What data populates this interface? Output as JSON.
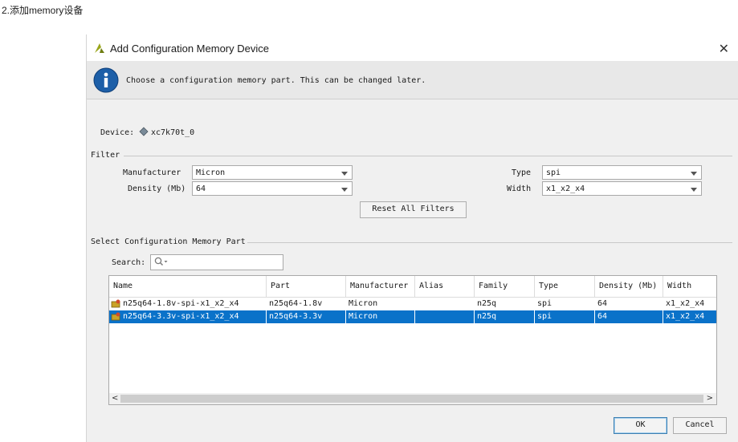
{
  "caption": "2.添加memory设备",
  "dialog": {
    "title": "Add Configuration Memory Device",
    "info_text": "Choose a configuration memory part. This can be changed later.",
    "device_label": "Device:",
    "device_value": "xc7k70t_0",
    "filter": {
      "section_label": "Filter",
      "manufacturer_label": "Manufacturer",
      "manufacturer_value": "Micron",
      "density_label": "Density (Mb)",
      "density_value": "64",
      "type_label": "Type",
      "type_value": "spi",
      "width_label": "Width",
      "width_value": "x1_x2_x4",
      "reset_label": "Reset All Filters"
    },
    "part_section": {
      "section_label": "Select Configuration Memory Part",
      "search_label": "Search:",
      "search_value": "",
      "columns": [
        "Name",
        "Part",
        "Manufacturer",
        "Alias",
        "Family",
        "Type",
        "Density (Mb)",
        "Width"
      ],
      "rows": [
        {
          "name": "n25q64-1.8v-spi-x1_x2_x4",
          "part": "n25q64-1.8v",
          "manufacturer": "Micron",
          "alias": "",
          "family": "n25q",
          "type": "spi",
          "density": "64",
          "width": "x1_x2_x4",
          "selected": false
        },
        {
          "name": "n25q64-3.3v-spi-x1_x2_x4",
          "part": "n25q64-3.3v",
          "manufacturer": "Micron",
          "alias": "",
          "family": "n25q",
          "type": "spi",
          "density": "64",
          "width": "x1_x2_x4",
          "selected": true
        }
      ]
    },
    "ok_label": "OK",
    "cancel_label": "Cancel"
  },
  "colors": {
    "selection": "#0a72c9",
    "info_icon": "#1d5fa8",
    "logo": "#8a9a1b"
  }
}
